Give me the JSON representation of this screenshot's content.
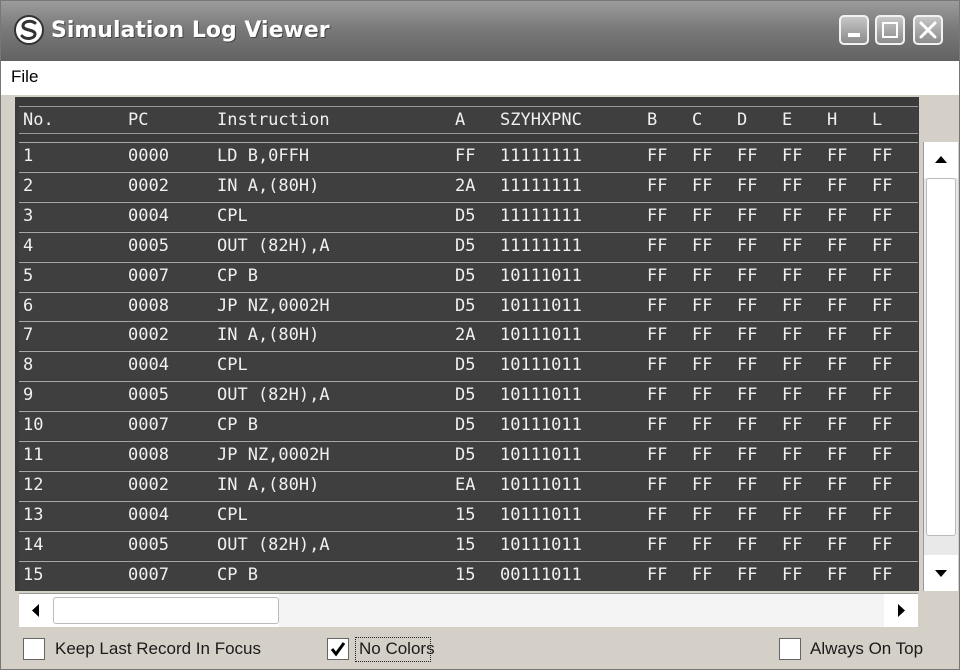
{
  "window": {
    "title": "Simulation Log Viewer"
  },
  "menu": {
    "file": "File"
  },
  "columns": [
    "No.",
    "PC",
    "Instruction",
    "A",
    "SZYHXPNC",
    "B",
    "C",
    "D",
    "E",
    "H",
    "L"
  ],
  "rows": [
    [
      "1",
      "0000",
      "LD B,0FFH",
      "FF",
      "11111111",
      "FF",
      "FF",
      "FF",
      "FF",
      "FF",
      "FF"
    ],
    [
      "2",
      "0002",
      "IN A,(80H)",
      "2A",
      "11111111",
      "FF",
      "FF",
      "FF",
      "FF",
      "FF",
      "FF"
    ],
    [
      "3",
      "0004",
      "CPL",
      "D5",
      "11111111",
      "FF",
      "FF",
      "FF",
      "FF",
      "FF",
      "FF"
    ],
    [
      "4",
      "0005",
      "OUT (82H),A",
      "D5",
      "11111111",
      "FF",
      "FF",
      "FF",
      "FF",
      "FF",
      "FF"
    ],
    [
      "5",
      "0007",
      "CP B",
      "D5",
      "10111011",
      "FF",
      "FF",
      "FF",
      "FF",
      "FF",
      "FF"
    ],
    [
      "6",
      "0008",
      "JP NZ,0002H",
      "D5",
      "10111011",
      "FF",
      "FF",
      "FF",
      "FF",
      "FF",
      "FF"
    ],
    [
      "7",
      "0002",
      "IN A,(80H)",
      "2A",
      "10111011",
      "FF",
      "FF",
      "FF",
      "FF",
      "FF",
      "FF"
    ],
    [
      "8",
      "0004",
      "CPL",
      "D5",
      "10111011",
      "FF",
      "FF",
      "FF",
      "FF",
      "FF",
      "FF"
    ],
    [
      "9",
      "0005",
      "OUT (82H),A",
      "D5",
      "10111011",
      "FF",
      "FF",
      "FF",
      "FF",
      "FF",
      "FF"
    ],
    [
      "10",
      "0007",
      "CP B",
      "D5",
      "10111011",
      "FF",
      "FF",
      "FF",
      "FF",
      "FF",
      "FF"
    ],
    [
      "11",
      "0008",
      "JP NZ,0002H",
      "D5",
      "10111011",
      "FF",
      "FF",
      "FF",
      "FF",
      "FF",
      "FF"
    ],
    [
      "12",
      "0002",
      "IN A,(80H)",
      "EA",
      "10111011",
      "FF",
      "FF",
      "FF",
      "FF",
      "FF",
      "FF"
    ],
    [
      "13",
      "0004",
      "CPL",
      "15",
      "10111011",
      "FF",
      "FF",
      "FF",
      "FF",
      "FF",
      "FF"
    ],
    [
      "14",
      "0005",
      "OUT (82H),A",
      "15",
      "10111011",
      "FF",
      "FF",
      "FF",
      "FF",
      "FF",
      "FF"
    ],
    [
      "15",
      "0007",
      "CP B",
      "15",
      "00111011",
      "FF",
      "FF",
      "FF",
      "FF",
      "FF",
      "FF"
    ]
  ],
  "status": {
    "keep_last_label": "Keep Last Record In Focus",
    "keep_last_checked": false,
    "no_colors_label": "No Colors",
    "no_colors_checked": true,
    "always_on_top_label": "Always On Top",
    "always_on_top_checked": false
  },
  "icons": {
    "app": "app-logo-icon",
    "minimize": "minimize-icon",
    "maximize": "maximize-icon",
    "close": "close-icon",
    "scroll_up": "scroll-up-arrow-icon",
    "scroll_down": "scroll-down-arrow-icon",
    "scroll_left": "scroll-left-arrow-icon",
    "scroll_right": "scroll-right-arrow-icon",
    "check": "checkmark-icon"
  },
  "colors": {
    "grid_bg": "#3f3f3f",
    "grid_text": "#f0f0f0",
    "title_bar": "#7a7a7a"
  }
}
